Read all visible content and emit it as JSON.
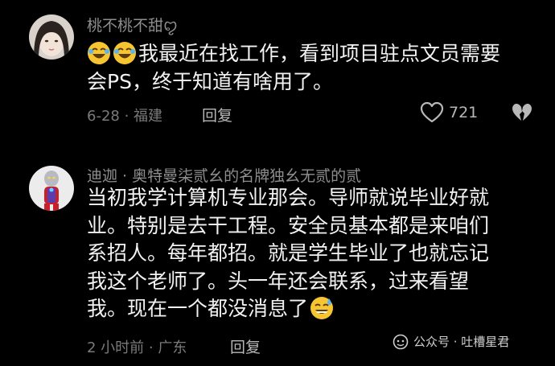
{
  "comments": [
    {
      "username": "桃不桃不甜ꨄ︎",
      "text_lines": [
        "我最近在找工作，看到项目驻点文员需要",
        "会PS，终于知道有啥用了。"
      ],
      "leading_emojis": [
        "rofl-emoji",
        "rofl-emoji"
      ],
      "meta": "6-28 · 福建",
      "reply_label": "回复",
      "likes": "721",
      "like_icon": "heart-outline-icon",
      "dislike_icon": "broken-heart-icon"
    },
    {
      "username": "迪迦 · 奥特曼柒贰幺的名牌独幺无贰的贰",
      "text_lines": [
        "当初我学计算机专业那会。导师就说毕业好就",
        "业。特别是去干工程。安全员基本都是来咱们",
        "系招人。每年都招。就是学生毕业了也就忘记",
        "我这个老师了。头一年还会联系，过来看望",
        "我。现在一个都没消息了"
      ],
      "trailing_emoji": "sweat-smile-emoji",
      "meta": "2 小时前 · 广东",
      "reply_label": "回复"
    }
  ],
  "watermark": {
    "text": "公众号 · 吐槽星君",
    "icon": "wechat-official-account-icon"
  },
  "colors": {
    "background": "#000000",
    "primary_text": "#f2f2f2",
    "secondary_text": "#8e8e8e",
    "emoji_yellow": "#f7c531"
  }
}
